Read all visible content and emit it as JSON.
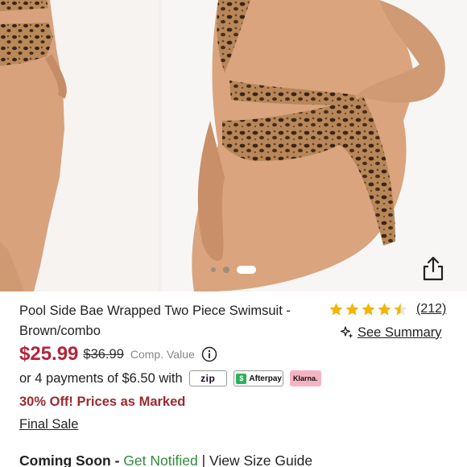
{
  "product": {
    "title": "Pool Side Bae Wrapped Two Piece Swimsuit - Brown/combo",
    "rating_value": 4.5,
    "review_count": "(212)",
    "summary_label": "See Summary"
  },
  "pricing": {
    "sale_price": "$25.99",
    "original_price": "$36.99",
    "comp_label": "Comp. Value",
    "sale_color": "#b3253a"
  },
  "payments": {
    "text": "or 4 payments of $6.50 with",
    "zip_label": "zip",
    "afterpay_label": "Afterpay",
    "klarna_label": "Klarna."
  },
  "promo": {
    "discount_text": "30% Off! Prices as Marked",
    "final_sale_label": "Final Sale"
  },
  "stock": {
    "coming_soon": "Coming Soon",
    "dash": " - ",
    "get_notified": "Get Notified",
    "separator": " | ",
    "size_guide": "View Size Guide"
  },
  "gallery": {
    "image_count": 3,
    "active_index": 2,
    "share_icon": "share-icon",
    "print_color": "#a87848"
  }
}
